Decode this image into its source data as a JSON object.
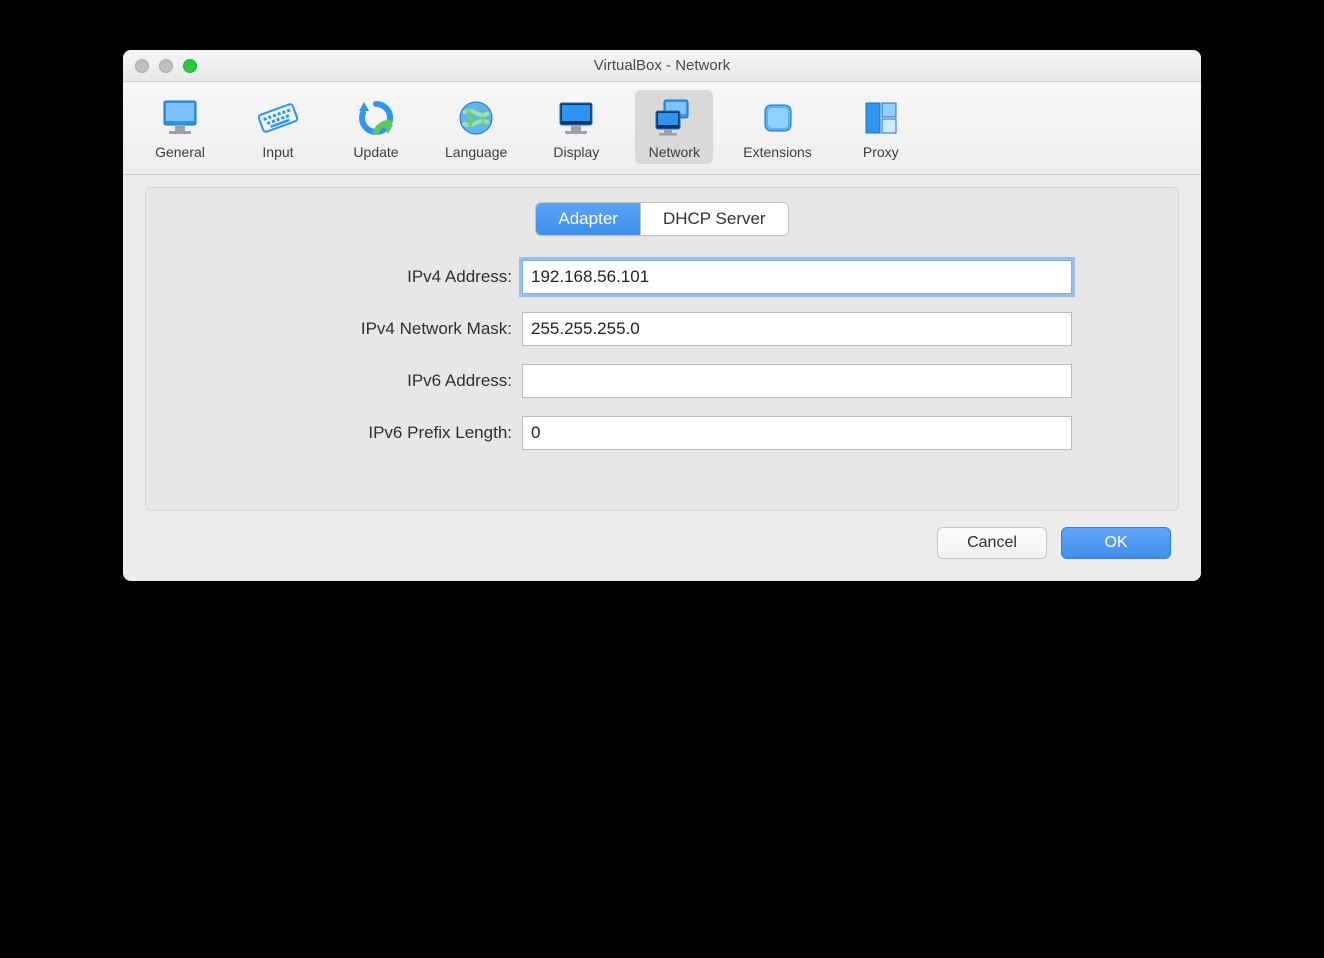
{
  "window": {
    "title": "VirtualBox - Network"
  },
  "toolbar": {
    "items": [
      {
        "label": "General"
      },
      {
        "label": "Input"
      },
      {
        "label": "Update"
      },
      {
        "label": "Language"
      },
      {
        "label": "Display"
      },
      {
        "label": "Network"
      },
      {
        "label": "Extensions"
      },
      {
        "label": "Proxy"
      }
    ],
    "selected": "Network"
  },
  "tabs": {
    "adapter": "Adapter",
    "dhcp": "DHCP Server",
    "active": "Adapter"
  },
  "form": {
    "ipv4_address": {
      "label": "IPv4 Address:",
      "value": "192.168.56.101"
    },
    "ipv4_netmask": {
      "label": "IPv4 Network Mask:",
      "value": "255.255.255.0"
    },
    "ipv6_address": {
      "label": "IPv6 Address:",
      "value": ""
    },
    "ipv6_prefix_length": {
      "label": "IPv6 Prefix Length:",
      "value": "0"
    }
  },
  "buttons": {
    "cancel": "Cancel",
    "ok": "OK"
  }
}
